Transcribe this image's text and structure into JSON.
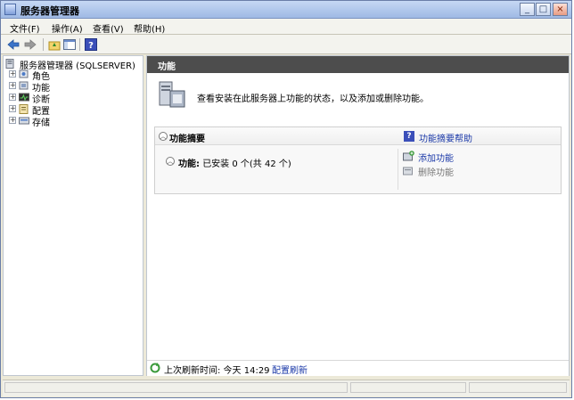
{
  "window": {
    "title": "服务器管理器",
    "controls": {
      "minimize": "_",
      "maximize": "□",
      "close": "×"
    }
  },
  "menubar": {
    "items": [
      {
        "label": "文件(F)"
      },
      {
        "label": "操作(A)"
      },
      {
        "label": "查看(V)"
      },
      {
        "label": "帮助(H)"
      }
    ]
  },
  "toolbar": {
    "buttons": [
      {
        "icon": "back-arrow-icon"
      },
      {
        "icon": "forward-arrow-icon"
      },
      {
        "icon": "up-folder-icon"
      },
      {
        "icon": "show-hide-console-tree-icon"
      },
      {
        "icon": "help-icon"
      }
    ]
  },
  "tree": {
    "root": {
      "label": "服务器管理器 (SQLSERVER)"
    },
    "items": [
      {
        "label": "角色",
        "expanded": false
      },
      {
        "label": "功能",
        "expanded": false,
        "selected": true
      },
      {
        "label": "诊断",
        "expanded": false
      },
      {
        "label": "配置",
        "expanded": false
      },
      {
        "label": "存储",
        "expanded": false
      }
    ]
  },
  "main": {
    "header": "功能",
    "intro": "查看安装在此服务器上功能的状态，以及添加或删除功能。",
    "summary": {
      "title": "功能摘要",
      "help_link": "功能摘要帮助",
      "status_label": "功能:",
      "status_value": "已安装 0 个(共 42 个)",
      "actions": [
        {
          "label": "添加功能",
          "enabled": true
        },
        {
          "label": "删除功能",
          "enabled": false
        }
      ]
    },
    "refresh": {
      "text": "上次刷新时间: 今天 14:29",
      "link": "配置刷新"
    }
  },
  "colors": {
    "header_bg": "#4d4d4d",
    "link": "#1b39a8",
    "window_border": "#6a7ea8"
  }
}
